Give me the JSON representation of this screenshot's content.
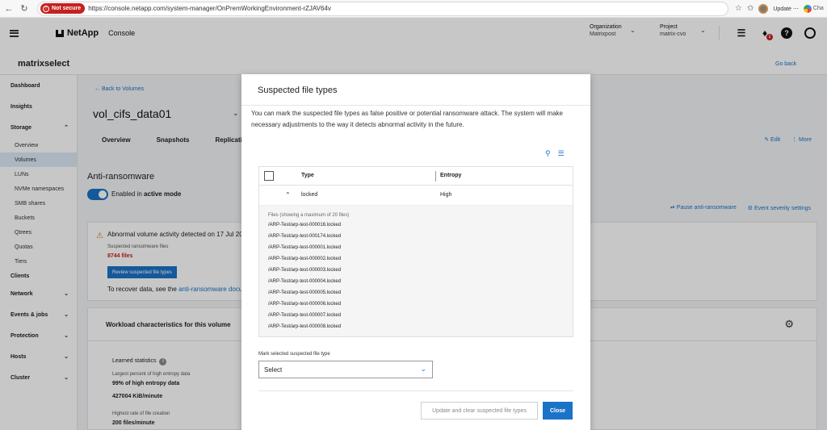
{
  "browser": {
    "not_secure": "Not secure",
    "url": "https://console.netapp.com/system-manager/OnPremWorkingEnvironment-rZJAV64v",
    "update_label": "Update",
    "chat_label": "Cha"
  },
  "header": {
    "brand": "NetApp",
    "console_label": "Console",
    "organization_label": "Organization",
    "organization_value": "Matrixpost",
    "project_label": "Project",
    "project_value": "matrix-cvo",
    "notifications_count": "1"
  },
  "subheader": {
    "working_environment": "matrixselect",
    "go_back": "Go back"
  },
  "sidebar": {
    "dashboard": "Dashboard",
    "insights": "Insights",
    "storage": "Storage",
    "storage_items": [
      "Overview",
      "Volumes",
      "LUNs",
      "NVMe namespaces",
      "SMB shares",
      "Buckets",
      "Qtrees",
      "Quotas",
      "Tiers"
    ],
    "clients": "Clients",
    "network": "Network",
    "events_jobs": "Events & jobs",
    "protection": "Protection",
    "hosts": "Hosts",
    "cluster": "Cluster"
  },
  "main": {
    "back_to_volumes": "Back to Volumes",
    "volume_name": "vol_cifs_data01",
    "tabs": [
      "Overview",
      "Snapshots",
      "Replicatio"
    ],
    "edit": "Edit",
    "more": "More",
    "anti_ransomware_title": "Anti-ransomware",
    "enabled_prefix": "Enabled in",
    "enabled_mode": "active mode",
    "pause_anti_ransomware": "Pause anti-ransomware",
    "event_severity_settings": "Event severity settings",
    "alert_title": "Abnormal volume activity detected on 17 Jul 20",
    "alert_sub": "Suspected ransomware files",
    "alert_count": "8744 files",
    "review_button": "Review suspected file types",
    "recover_prefix": "To recover data, see the",
    "recover_link": "anti-ransomware docu",
    "workload_title": "Workload characteristics for this volume",
    "learned_statistics": "Learned statistics",
    "ls_entropy_label": "Largest percent of high entropy data",
    "ls_entropy_value": "99% of high entropy data",
    "ls_rate_value": "427004 KiB/minute",
    "ls_creation_label": "Highest rate of file creation",
    "ls_creation_value": "200 files/minute"
  },
  "modal": {
    "title": "Suspected file types",
    "description": "You can mark the suspected file types as false positive or potential ransomware attack. The system will make necessary adjustments to the way it detects abnormal activity in the future.",
    "col_type": "Type",
    "col_entropy": "Entropy",
    "row_type": "locked",
    "row_entropy": "High",
    "files_caption": "Files (showing a maximum of 20 files)",
    "files": [
      "/ARP-Test/arp-test-000016.locked",
      "/ARP-Test/arp-test-000174.locked",
      "/ARP-Test/arp-test-000001.locked",
      "/ARP-Test/arp-test-000002.locked",
      "/ARP-Test/arp-test-000003.locked",
      "/ARP-Test/arp-test-000004.locked",
      "/ARP-Test/arp-test-000005.locked",
      "/ARP-Test/arp-test-000006.locked",
      "/ARP-Test/arp-test-000007.locked",
      "/ARP-Test/arp-test-000008.locked"
    ],
    "mark_label": "Mark selected suspected file type",
    "select_value": "Select",
    "update_button": "Update and clear suspected file types",
    "close_button": "Close"
  },
  "colors": {
    "accent": "#1a73c6",
    "danger": "#c5221f",
    "warning": "#d4760a"
  }
}
